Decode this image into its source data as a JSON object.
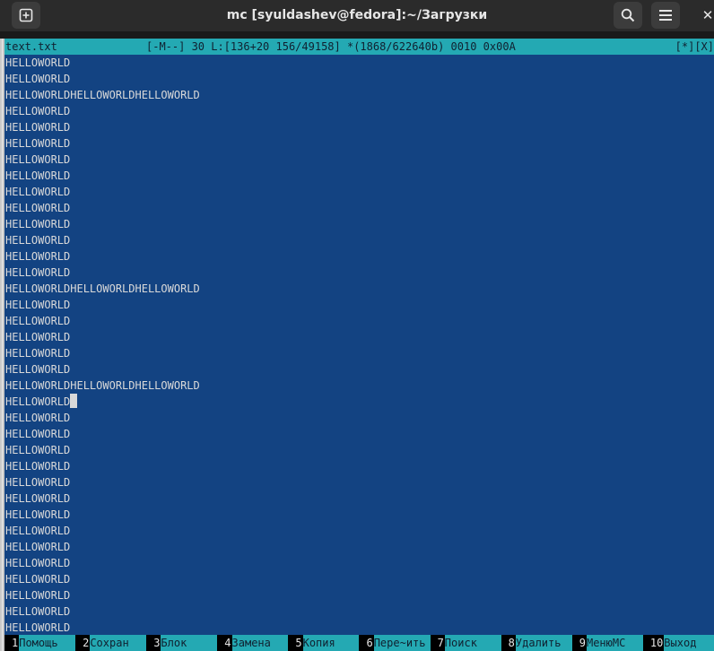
{
  "window": {
    "title": "mc [syuldashev@fedora]:~/Загрузки",
    "icons": {
      "new_tab": "plus-icon",
      "search": "search-icon",
      "menu": "hamburger-icon",
      "close": "close-icon"
    },
    "close_glyph": "✕"
  },
  "status": {
    "filename": "text.txt",
    "info": "[-M--] 30 L:[136+20 156/49158] *(1868/622640b) 0010 0x00A",
    "flags": "[*][X]"
  },
  "editor": {
    "lines": [
      "HELLOWORLD",
      "HELLOWORLD",
      "HELLOWORLDHELLOWORLDHELLOWORLD",
      "HELLOWORLD",
      "HELLOWORLD",
      "HELLOWORLD",
      "HELLOWORLD",
      "HELLOWORLD",
      "HELLOWORLD",
      "HELLOWORLD",
      "HELLOWORLD",
      "HELLOWORLD",
      "HELLOWORLD",
      "HELLOWORLD",
      "HELLOWORLDHELLOWORLDHELLOWORLD",
      "HELLOWORLD",
      "HELLOWORLD",
      "HELLOWORLD",
      "HELLOWORLD",
      "HELLOWORLD",
      "HELLOWORLDHELLOWORLDHELLOWORLD",
      "HELLOWORLD",
      "HELLOWORLD",
      "HELLOWORLD",
      "HELLOWORLD",
      "HELLOWORLD",
      "HELLOWORLD",
      "HELLOWORLD",
      "HELLOWORLD",
      "HELLOWORLD",
      "HELLOWORLD",
      "HELLOWORLD",
      "HELLOWORLD",
      "HELLOWORLD",
      "HELLOWORLD",
      "HELLOWORLD"
    ],
    "cursor_line": 21
  },
  "keybar": [
    {
      "num": "1",
      "label": "Помощь"
    },
    {
      "num": "2",
      "label": "Сохран"
    },
    {
      "num": "3",
      "label": "Блок"
    },
    {
      "num": "4",
      "label": "Замена"
    },
    {
      "num": "5",
      "label": "Копия"
    },
    {
      "num": "6",
      "label": "Пере~ить"
    },
    {
      "num": "7",
      "label": "Поиск"
    },
    {
      "num": "8",
      "label": "Удалить"
    },
    {
      "num": "9",
      "label": "МенюMC"
    },
    {
      "num": "10",
      "label": "Выход"
    }
  ],
  "colors": {
    "editor_bg": "#134382",
    "bar_bg": "#24a9b3",
    "titlebar_bg": "#2b2b2b"
  }
}
